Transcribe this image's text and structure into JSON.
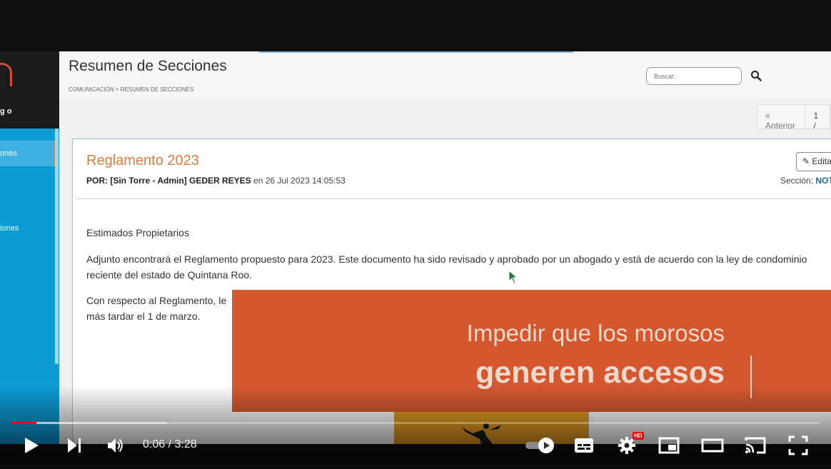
{
  "sidebar": {
    "logo_text": "g o",
    "items": [
      {
        "label": "ones"
      },
      {
        "label": "iones"
      }
    ]
  },
  "header": {
    "title": "Resumen de Secciones",
    "breadcrumb": "COMUNICACIÓN > RESUMEN DE SECCIONES",
    "search_placeholder": "Buscar:"
  },
  "pager": {
    "prev": "« Anterior",
    "page": "1 /"
  },
  "post": {
    "title": "Reglamento 2023",
    "author_prefix": "POR: [Sin Torre - Admin] GEDER REYES",
    "date": " en 26 Jul 2023 14:05:53",
    "edit_label": "Edita",
    "section_prefix": "Sección: ",
    "section_value": "NOT",
    "paragraphs": [
      "Estimados Propietarios",
      " Adjunto encontrará el Reglamento propuesto para 2023. Este documento ha sido revisado y aprobado por un abogado y está de acuerdo con la ley de condominio",
      "reciente del estado de Quintana Roo.",
      "Con respecto al Reglamento, le",
      "más tardar el 1 de marzo."
    ]
  },
  "overlay": {
    "line1": "Impedir que los morosos",
    "line2": "generen accesos"
  },
  "player": {
    "time": "0:06 / 3:28",
    "progress_played": 0.031,
    "progress_buffered": 0.193,
    "hd_badge": "HD",
    "colors": {
      "played": "#ff0000",
      "accent": "#e07b39",
      "sidebar": "#0c9bd3",
      "banner": "#d4572e"
    }
  }
}
